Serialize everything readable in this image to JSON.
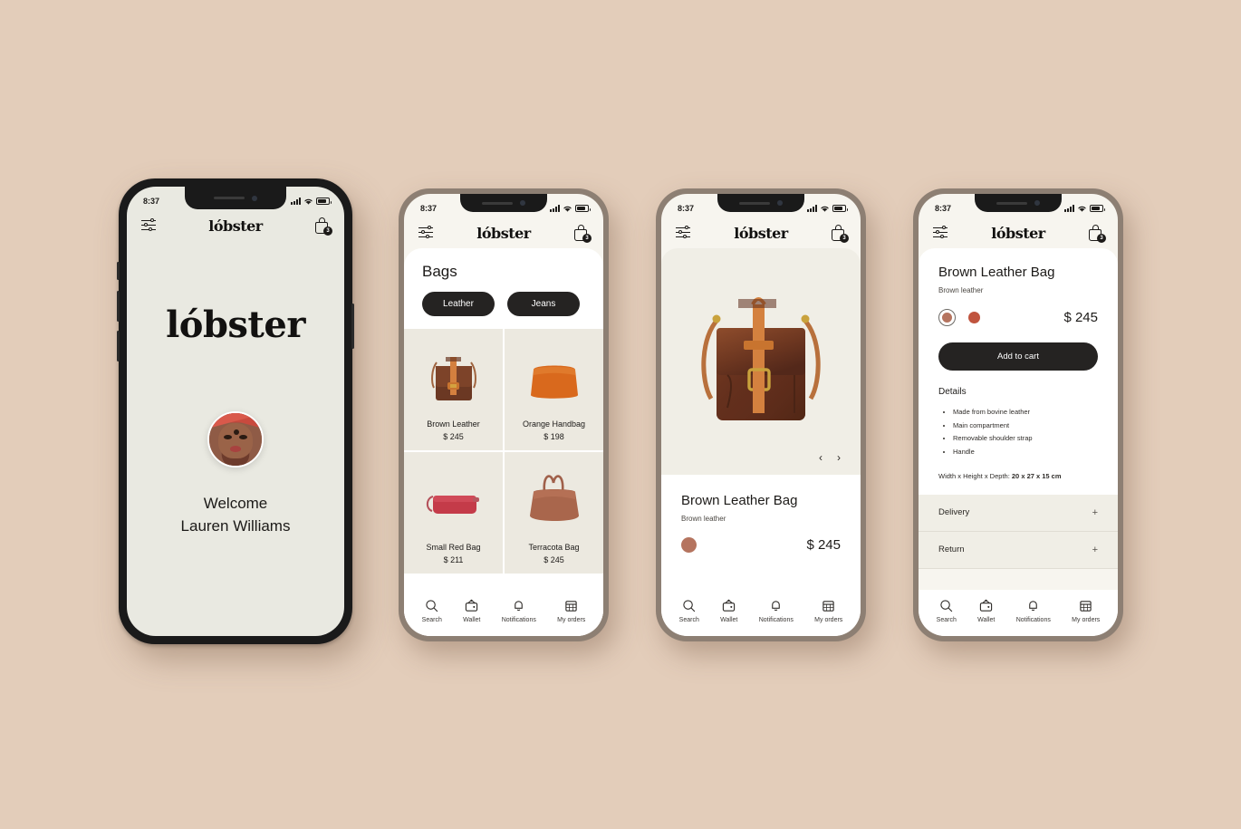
{
  "brand": {
    "name": "lóbster",
    "logo_text": "lóbster"
  },
  "colors": {
    "page_background": "#e3cdba",
    "dark": "#252322",
    "screen_cream": "#e9e9e1",
    "sheet_grey": "#f0eee6",
    "swatch_brown": "#b5745f",
    "swatch_red": "#c0543e"
  },
  "statusbar": {
    "time": "8:37",
    "signal_icon": "signal-bars-icon",
    "wifi_icon": "wifi-icon",
    "battery_icon": "battery-icon"
  },
  "header": {
    "filter_icon": "filter-sliders-icon",
    "bag_icon": "shopping-bag-icon",
    "bag_badge": "3"
  },
  "nav": {
    "items": [
      {
        "label": "Search",
        "icon": "search-icon"
      },
      {
        "label": "Wallet",
        "icon": "wallet-icon"
      },
      {
        "label": "Notifications",
        "icon": "bell-icon"
      },
      {
        "label": "My orders",
        "icon": "calendar-icon"
      }
    ]
  },
  "screen_welcome": {
    "greeting": "Welcome",
    "user_name": "Lauren Williams",
    "avatar": "user-avatar"
  },
  "screen_catalog": {
    "title": "Bags",
    "chips": [
      {
        "label": "Leather",
        "active": true
      },
      {
        "label": "Jeans",
        "active": false
      }
    ],
    "products": [
      {
        "name": "Brown Leather",
        "price": "$ 245",
        "image": "brown-leather-messenger-bag"
      },
      {
        "name": "Orange Handbag",
        "price": "$ 198",
        "image": "orange-handbag"
      },
      {
        "name": "Small Red Bag",
        "price": "$ 211",
        "image": "small-red-bag"
      },
      {
        "name": "Terracota Bag",
        "price": "$ 245",
        "image": "terracota-tote-bag"
      }
    ]
  },
  "screen_product": {
    "title": "Brown Leather Bag",
    "subtitle": "Brown leather",
    "price": "$ 245",
    "image": "brown-leather-messenger-bag",
    "prev_arrow": "‹",
    "next_arrow": "›",
    "swatch_color": "#b5745f"
  },
  "screen_details": {
    "title": "Brown Leather Bag",
    "subtitle": "Brown leather",
    "price": "$ 245",
    "add_to_cart": "Add to cart",
    "details_heading": "Details",
    "details": [
      "Made from bovine leather",
      "Main compartment",
      "Removable shoulder strap",
      "Handle"
    ],
    "dimensions_label": "Width x Height x Depth:",
    "dimensions_value": "20 x 27 x 15 cm",
    "accordions": [
      {
        "label": "Delivery",
        "expander": "+"
      },
      {
        "label": "Return",
        "expander": "+"
      }
    ]
  }
}
